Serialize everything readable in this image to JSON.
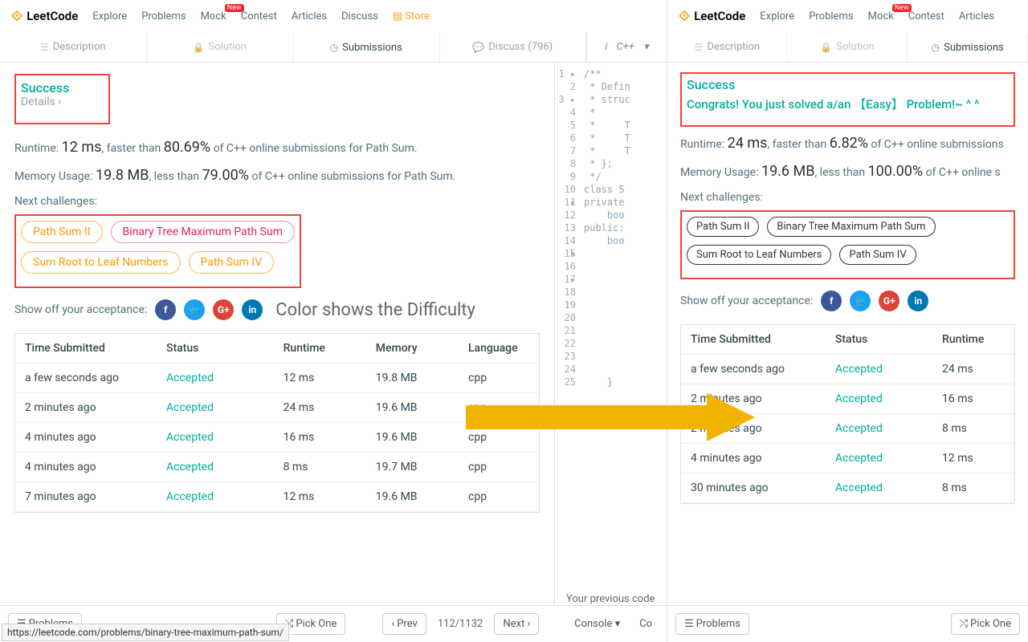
{
  "brand": "LeetCode",
  "nav": [
    "Explore",
    "Problems",
    "Mock",
    "Contest",
    "Articles",
    "Discuss",
    "Store"
  ],
  "nav_new_badge": "New",
  "tabs": {
    "description": "Description",
    "solution": "Solution",
    "submissions": "Submissions",
    "discuss": "Discuss (796)"
  },
  "lang": "C++",
  "left": {
    "success": "Success",
    "details": "Details",
    "runtime_label": "Runtime:",
    "runtime_value": "12 ms",
    "runtime_rest1": ", faster than",
    "runtime_pct": "80.69%",
    "runtime_rest2": "of C++ online submissions for Path Sum.",
    "memory_label": "Memory Usage:",
    "memory_value": "19.8 MB",
    "memory_rest1": ", less than",
    "memory_pct": "79.00%",
    "memory_rest2": "of C++ online submissions for Path Sum.",
    "next_label": "Next challenges:",
    "challenges": [
      {
        "name": "Path Sum II",
        "diff": "medium"
      },
      {
        "name": "Binary Tree Maximum Path Sum",
        "diff": "hard"
      },
      {
        "name": "Sum Root to Leaf Numbers",
        "diff": "medium"
      },
      {
        "name": "Path Sum IV",
        "diff": "medium"
      }
    ],
    "showoff": "Show off your acceptance:",
    "caption": "Color shows the Difficulty",
    "headers": [
      "Time Submitted",
      "Status",
      "Runtime",
      "Memory",
      "Language"
    ],
    "rows": [
      [
        "a few seconds ago",
        "Accepted",
        "12 ms",
        "19.8 MB",
        "cpp"
      ],
      [
        "2 minutes ago",
        "Accepted",
        "24 ms",
        "19.6 MB",
        "cpp"
      ],
      [
        "4 minutes ago",
        "Accepted",
        "16 ms",
        "19.6 MB",
        "cpp"
      ],
      [
        "4 minutes ago",
        "Accepted",
        "8 ms",
        "19.7 MB",
        "cpp"
      ],
      [
        "7 minutes ago",
        "Accepted",
        "12 ms",
        "19.6 MB",
        "cpp"
      ]
    ]
  },
  "editor_lines": [
    "/**",
    " * Defin",
    " * struc",
    " *     ",
    " *     T",
    " *     T",
    " *     T",
    " * };",
    " */",
    "class S",
    "private",
    "    boo",
    "public:",
    "    boo",
    "",
    "",
    "",
    "",
    "",
    "",
    "",
    "",
    "",
    "",
    "    }"
  ],
  "footer": {
    "problems": "Problems",
    "pickone": "Pick One",
    "prev": "Prev",
    "next": "Next",
    "page": "112/1132",
    "console": "Console",
    "coc": "Co",
    "prevcode": "Your previous code"
  },
  "url": "https://leetcode.com/problems/binary-tree-maximum-path-sum/",
  "right": {
    "success": "Success",
    "congrats_pre": "Congrats! You just solved a/an ",
    "congrats_mid": "【Easy】",
    "congrats_post": " Problem!~ ^ ^",
    "runtime_label": "Runtime:",
    "runtime_value": "24 ms",
    "runtime_rest1": ", faster than",
    "runtime_pct": "6.82%",
    "runtime_rest2": "of C++ online submissions",
    "memory_label": "Memory Usage:",
    "memory_value": "19.6 MB",
    "memory_rest1": ", less than",
    "memory_pct": "100.00%",
    "memory_rest2": "of C++ online s",
    "next_label": "Next challenges:",
    "challenges": [
      "Path Sum II",
      "Binary Tree Maximum Path Sum",
      "Sum Root to Leaf Numbers",
      "Path Sum IV"
    ],
    "showoff": "Show off your acceptance:",
    "headers": [
      "Time Submitted",
      "Status",
      "Runtime"
    ],
    "rows": [
      [
        "a few seconds ago",
        "Accepted",
        "24 ms"
      ],
      [
        "2 minutes ago",
        "Accepted",
        "16 ms"
      ],
      [
        "2 minutes ago",
        "Accepted",
        "8 ms"
      ],
      [
        "4 minutes ago",
        "Accepted",
        "12 ms"
      ],
      [
        "30 minutes ago",
        "Accepted",
        "8 ms"
      ]
    ]
  }
}
